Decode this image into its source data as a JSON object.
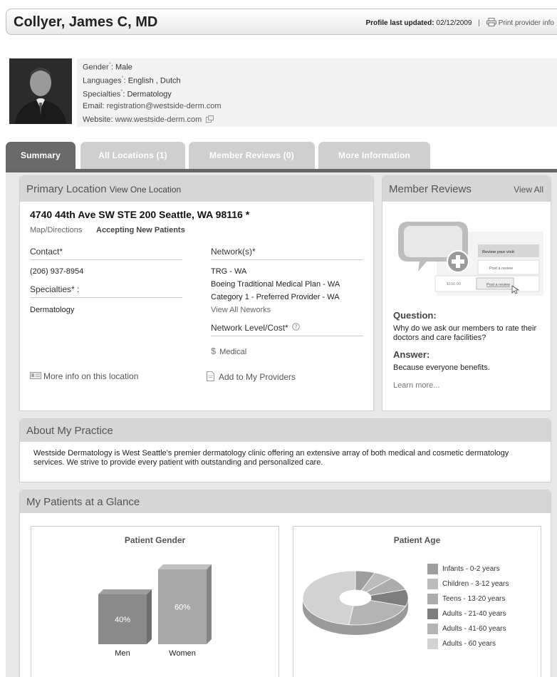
{
  "header": {
    "name": "Collyer, James C, MD",
    "updated_label": "Profile last updated:",
    "updated_date": "02/12/2009",
    "separator": "|",
    "print_label": "Print provider info"
  },
  "profile": {
    "gender_label": "Gender",
    "gender_value": ": Male",
    "languages_label": "Languages",
    "languages_value": ": English , Dutch",
    "specialties_label": "Specialties",
    "specialties_value": ": Dermatology",
    "email_label": "Email:",
    "email_value": "registration@westside-derm.com",
    "website_label": "Website:",
    "website_value": "www.westside-derm.com",
    "asterisk": "*"
  },
  "tabs": [
    {
      "label": "Summary",
      "active": true
    },
    {
      "label": "All Locations (1)",
      "active": false
    },
    {
      "label": "Member Reviews (0)",
      "active": false
    },
    {
      "label": "More Information",
      "active": false
    }
  ],
  "primary_location": {
    "title": "Primary Location",
    "view_link": "View One Location",
    "address": "4740 44th Ave SW STE 200 Seattle, WA 98116 *",
    "map_link": "Map/Directions",
    "accepting": "Accepting New Patients",
    "contact_label": "Contact*",
    "phone": "(206) 937-8954",
    "specialties_label": "Specialties*",
    "specialties_colon": " :",
    "specialty": "Dermatology",
    "networks_label": "Network(s)*",
    "networks": [
      "TRG - WA",
      "Boeing Traditional Medical Plan - WA",
      "Category 1 - Preferred Provider - WA"
    ],
    "view_all_networks": "View All Neworks",
    "network_level_label": "Network Level/Cost*",
    "network_level_value": "Medical",
    "more_info": "More info on this location",
    "add_to": "Add to My Providers"
  },
  "member_reviews": {
    "title": "Member Reviews",
    "view_all": "View All",
    "illus_header": "Review your visit",
    "illus_post1": "Post a review",
    "illus_price": "$150.00",
    "illus_post2": "Post a review",
    "question_label": "Question:",
    "question_text": "Why do we ask our members to rate their doctors and care facilities?",
    "answer_label": "Answer:",
    "answer_text": "Because everyone benefits.",
    "learn_more": "Learn more..."
  },
  "about": {
    "title": "About My Practice",
    "text": "Westside Dermatology is West Seattle's premier dermatology clinic offering an extensive array of both medical and cosmetic dermatology services. We strive to provide every patient with outstanding and personalized care."
  },
  "glance": {
    "title": "My Patients at a Glance"
  },
  "chart_data": [
    {
      "type": "bar",
      "title": "Patient Gender",
      "categories": [
        "Men",
        "Women"
      ],
      "values": [
        40,
        60
      ],
      "value_labels": [
        "40%",
        "60%"
      ],
      "ylim": [
        0,
        60
      ],
      "colors": [
        "#8a8a8a",
        "#a8a8a8"
      ]
    },
    {
      "type": "pie",
      "title": "Patient Age",
      "labels": [
        "Infants - 0-2 years",
        "Children - 3-12 years",
        "Teens - 13-20 years",
        "Adults - 21-40 years",
        "Adults - 41-60 years",
        "Adults - 60  years"
      ],
      "values": [
        6,
        6,
        8,
        10,
        22,
        48
      ],
      "colors": [
        "#9e9e9e",
        "#bcbcbc",
        "#acacac",
        "#7e7e7e",
        "#b4b4b4",
        "#d2d2d2"
      ]
    }
  ]
}
